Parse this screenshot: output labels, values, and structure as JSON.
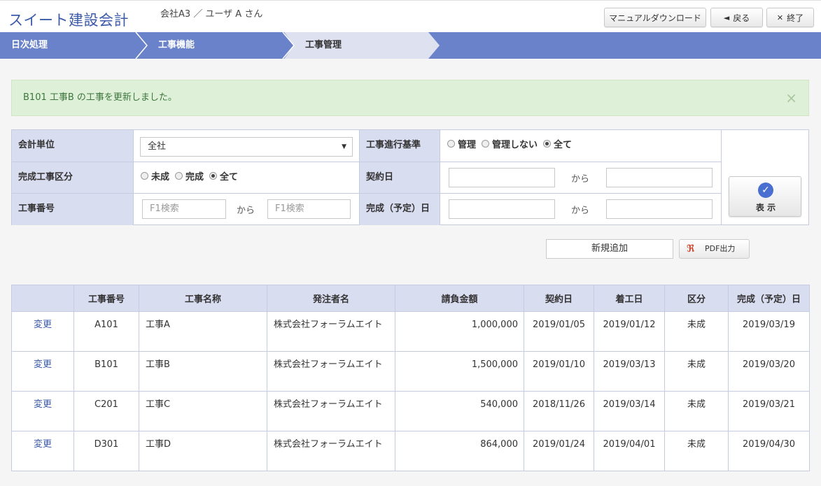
{
  "app": {
    "title": "スイート建設会計",
    "user_info": "会社A3 ／ ユーザ A さん"
  },
  "top_buttons": {
    "manual": "マニュアルダウンロード",
    "back": "戻る",
    "exit": "終了"
  },
  "breadcrumb": [
    "日次処理",
    "工事機能",
    "工事管理"
  ],
  "alert": {
    "message": "B101 工事B の工事を更新しました。",
    "close": "×"
  },
  "filter": {
    "company_unit": {
      "label": "会計単位",
      "value": "全社"
    },
    "progress_basis": {
      "label": "工事進行基準",
      "options": [
        "管理",
        "管理しない",
        "全て"
      ],
      "selected": "全て"
    },
    "completion_type": {
      "label": "完成工事区分",
      "options": [
        "未成",
        "完成",
        "全て"
      ],
      "selected": "全て"
    },
    "contract_date": {
      "label": "契約日",
      "from": "",
      "to": "",
      "separator": "から"
    },
    "project_number": {
      "label": "工事番号",
      "from_placeholder": "F1検索",
      "to_placeholder": "F1検索",
      "separator": "から"
    },
    "completion_date": {
      "label": "完成（予定）日",
      "from": "",
      "to": "",
      "separator": "から"
    },
    "show_button": "表 示"
  },
  "actions": {
    "new": "新規追加",
    "pdf": "PDF出力"
  },
  "table": {
    "headers": [
      "",
      "工事番号",
      "工事名称",
      "発注者名",
      "請負金額",
      "契約日",
      "着工日",
      "区分",
      "完成（予定）日"
    ],
    "rows": [
      {
        "action": "変更",
        "number": "A101",
        "name": "工事A",
        "client": "株式会社フォーラムエイト",
        "amount": "1,000,000",
        "contract": "2019/01/05",
        "start": "2019/01/12",
        "type": "未成",
        "complete": "2019/03/19"
      },
      {
        "action": "変更",
        "number": "B101",
        "name": "工事B",
        "client": "株式会社フォーラムエイト",
        "amount": "1,500,000",
        "contract": "2019/01/10",
        "start": "2019/03/13",
        "type": "未成",
        "complete": "2019/03/20"
      },
      {
        "action": "変更",
        "number": "C201",
        "name": "工事C",
        "client": "株式会社フォーラムエイト",
        "amount": "540,000",
        "contract": "2018/11/26",
        "start": "2019/03/14",
        "type": "未成",
        "complete": "2019/03/21"
      },
      {
        "action": "変更",
        "number": "D301",
        "name": "工事D",
        "client": "株式会社フォーラムエイト",
        "amount": "864,000",
        "contract": "2019/01/24",
        "start": "2019/04/01",
        "type": "未成",
        "complete": "2019/04/30"
      }
    ]
  }
}
